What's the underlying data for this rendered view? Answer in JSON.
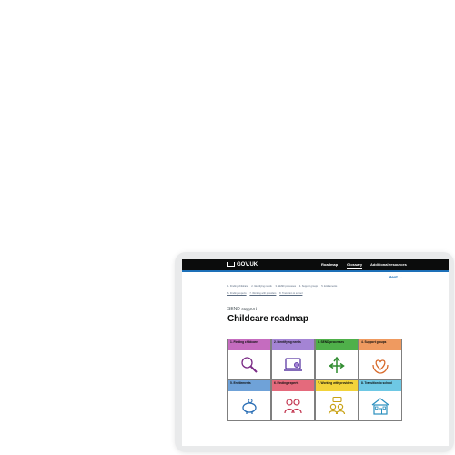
{
  "header": {
    "logo_text": "GOV.UK",
    "nav": [
      "Roadmap",
      "Glossary",
      "Additional resources"
    ]
  },
  "next_label": "Next",
  "breadcrumbs": {
    "row1": [
      "1. Finding childcare",
      "2. Identifying needs",
      "3. SEND processes",
      "4. Support groups",
      "5. Entitlements"
    ],
    "row2": [
      "6. Finding experts",
      "7. Working with providers",
      "8. Transition to school"
    ]
  },
  "caption": "SEND support",
  "title": "Childcare roadmap",
  "tiles": [
    {
      "label": "1. Finding childcare",
      "color": "#c56cbf",
      "icon": "magnifier-icon",
      "stroke": "#7b2c86"
    },
    {
      "label": "2. Identifying needs",
      "color": "#a484d4",
      "icon": "laptop-icon",
      "stroke": "#5c3aa3"
    },
    {
      "label": "3. SEND processes",
      "color": "#4fb04a",
      "icon": "direction-arrows-icon",
      "stroke": "#2e8b2e"
    },
    {
      "label": "4. Support groups",
      "color": "#ef9a60",
      "icon": "heart-hands-icon",
      "stroke": "#d8692a"
    },
    {
      "label": "5. Entitlements",
      "color": "#6fa2d8",
      "icon": "piggy-bank-icon",
      "stroke": "#2a6eb5"
    },
    {
      "label": "6. Finding experts",
      "color": "#e46a7c",
      "icon": "experts-icon",
      "stroke": "#c23650"
    },
    {
      "label": "7. Working with providers",
      "color": "#f2d33a",
      "icon": "chat-people-icon",
      "stroke": "#c9a215"
    },
    {
      "label": "8. Transition to school",
      "color": "#6ec8e4",
      "icon": "school-icon",
      "stroke": "#2a8fbf"
    }
  ]
}
